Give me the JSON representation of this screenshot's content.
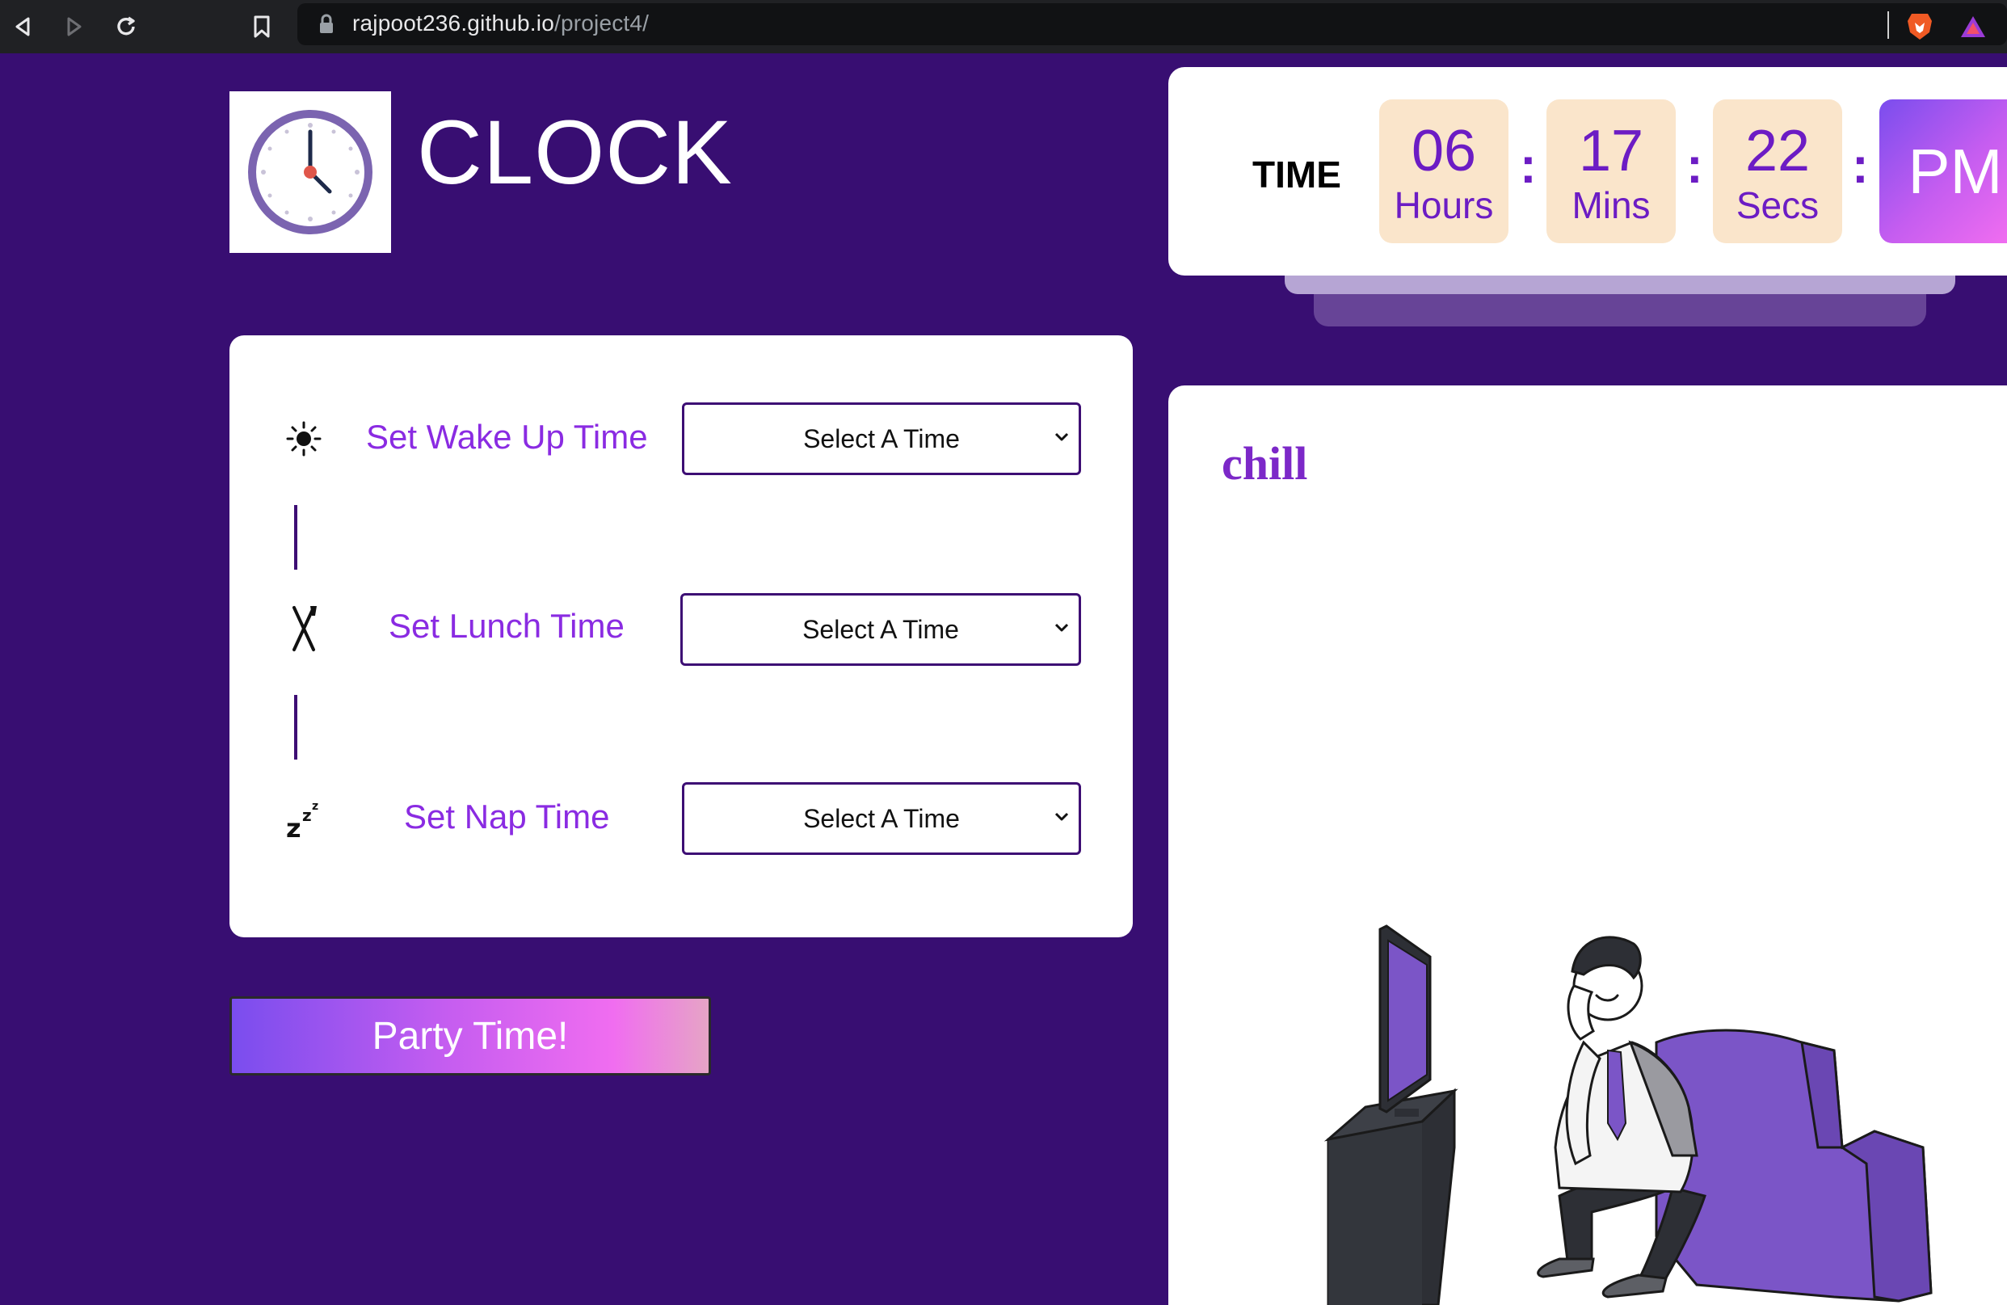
{
  "browser": {
    "url_host": "rajpoot236.github.io",
    "url_path": "/project4/"
  },
  "header": {
    "title": "CLOCK"
  },
  "clock": {
    "label": "TIME",
    "hours": "06",
    "hours_label": "Hours",
    "minutes": "17",
    "minutes_label": "Mins",
    "seconds": "22",
    "seconds_label": "Secs",
    "separator": ":",
    "ampm": "PM"
  },
  "schedule": {
    "wake": {
      "label": "Set Wake Up Time",
      "value": "Select A Time",
      "icon": "sun-icon"
    },
    "lunch": {
      "label": "Set Lunch Time",
      "value": "Select A Time",
      "icon": "fork-knife-icon"
    },
    "nap": {
      "label": "Set Nap Time",
      "value": "Select A Time",
      "icon": "sleep-zzz-icon"
    }
  },
  "party_button": "Party Time!",
  "mood": {
    "title": "chill",
    "illustration": "man-watching-tv-illustration"
  },
  "colors": {
    "page_bg": "#380e72",
    "accent_purple": "#8a2be2",
    "time_box_bg": "#fae5cb",
    "gradient_start": "#7a4dee",
    "gradient_end": "#f06df0"
  }
}
